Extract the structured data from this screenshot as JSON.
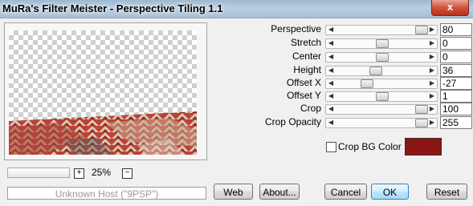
{
  "window": {
    "title": "MuRa's Filter Meister - Perspective Tiling 1.1",
    "close_symbol": "x"
  },
  "zoom": {
    "minus": "−",
    "plus": "+",
    "value": "25%"
  },
  "status": "Unknown Host (\"9PSP\")",
  "params": [
    {
      "label": "Perspective",
      "value": "80",
      "fraction": 0.93
    },
    {
      "label": "Stretch",
      "value": "0",
      "fraction": 0.5
    },
    {
      "label": "Center",
      "value": "0",
      "fraction": 0.5
    },
    {
      "label": "Height",
      "value": "36",
      "fraction": 0.43
    },
    {
      "label": "Offset X",
      "value": "-27",
      "fraction": 0.33
    },
    {
      "label": "Offset Y",
      "value": "1",
      "fraction": 0.5
    },
    {
      "label": "Crop",
      "value": "100",
      "fraction": 0.93
    },
    {
      "label": "Crop Opacity",
      "value": "255",
      "fraction": 0.93
    }
  ],
  "crop_bg": {
    "label": "Crop BG Color",
    "checked": false,
    "color": "#8b1414"
  },
  "buttons": {
    "web": "Web",
    "about": "About...",
    "cancel": "Cancel",
    "ok": "OK",
    "reset": "Reset"
  }
}
